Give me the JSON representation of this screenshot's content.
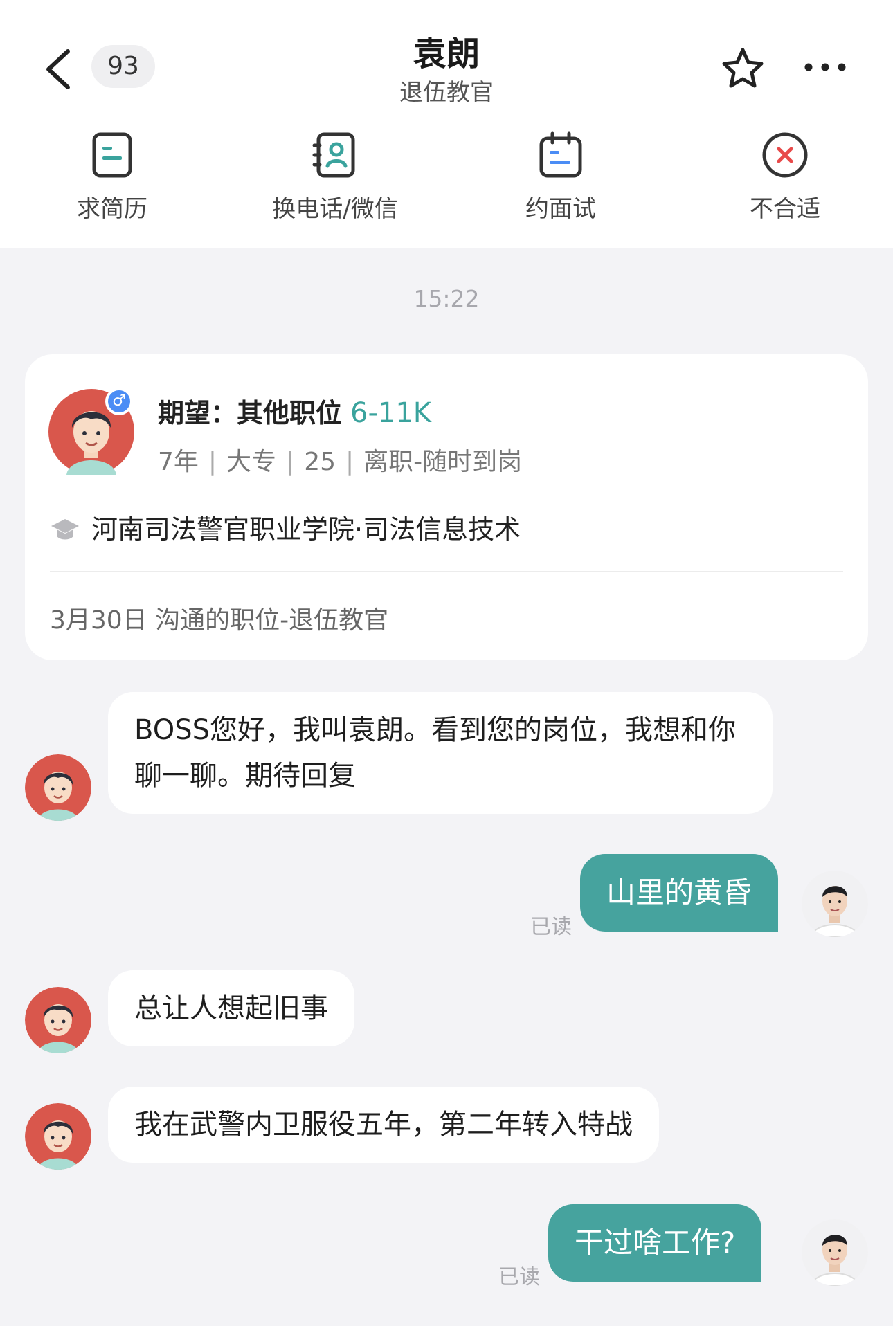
{
  "header": {
    "unread_count": "93",
    "name": "袁朗",
    "position": "退伍教官"
  },
  "actions": [
    {
      "label": "求简历",
      "icon": "resume-icon"
    },
    {
      "label": "换电话/微信",
      "icon": "contact-card-icon"
    },
    {
      "label": "约面试",
      "icon": "calendar-icon"
    },
    {
      "label": "不合适",
      "icon": "reject-icon"
    }
  ],
  "chat": {
    "timestamp": "15:22",
    "candidate_card": {
      "expect_label": "期望：其他职位",
      "salary": "6-11K",
      "experience": "7年",
      "education": "大专",
      "age": "25",
      "status": "离职-随时到岗",
      "school": "河南司法警官职业学院·司法信息技术",
      "footer": "3月30日 沟通的职位-退伍教官",
      "gender_symbol": "♂"
    },
    "messages": [
      {
        "from": "candidate",
        "text": "BOSS您好，我叫袁朗。看到您的岗位，我想和你聊一聊。期待回复"
      },
      {
        "from": "me",
        "text": "山里的黄昏",
        "read": "已读"
      },
      {
        "from": "candidate",
        "text": "总让人想起旧事"
      },
      {
        "from": "candidate",
        "text": "我在武警内卫服役五年，第二年转入特战"
      },
      {
        "from": "me",
        "text": "干过啥工作?",
        "read": "已读"
      }
    ]
  },
  "colors": {
    "accent": "#46a39e",
    "salary": "#3aa39d",
    "reject": "#e84a4a",
    "background": "#f3f3f6"
  }
}
